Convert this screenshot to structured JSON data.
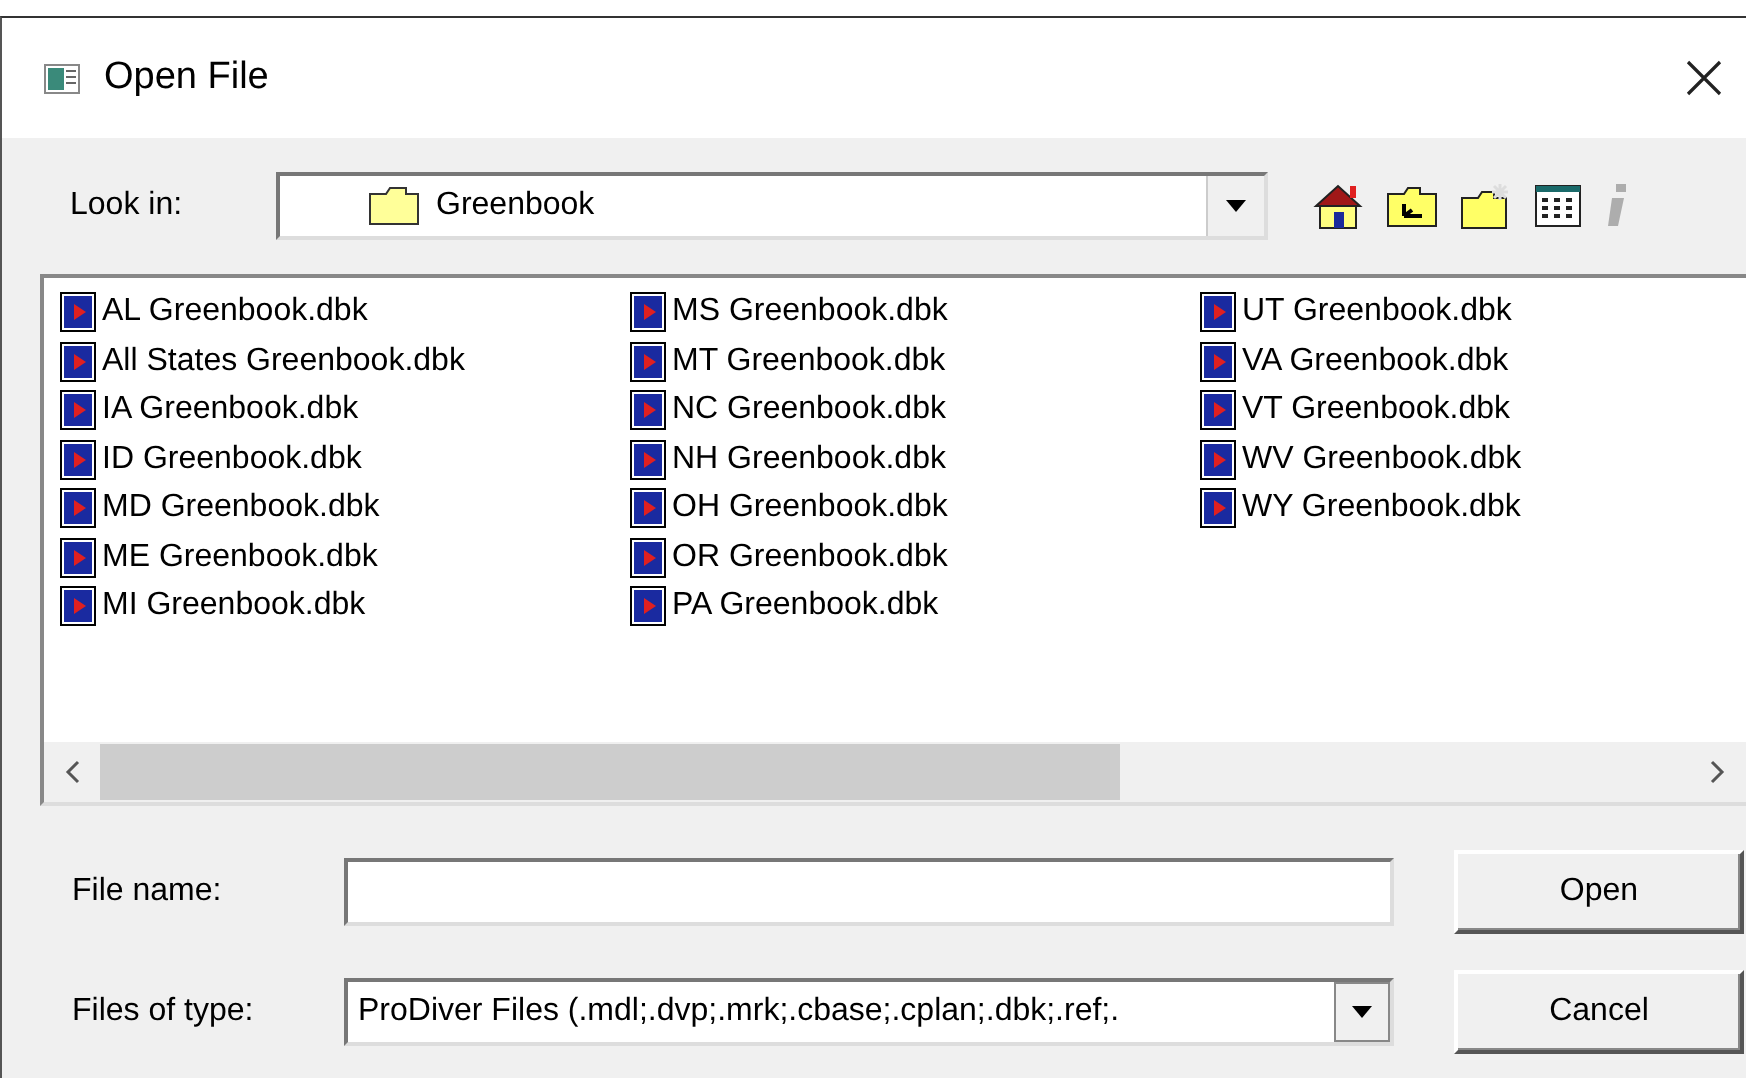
{
  "window": {
    "title": "Open File"
  },
  "look_in": {
    "label": "Look in:",
    "value": "Greenbook"
  },
  "toolbar": [
    {
      "kind": "home",
      "disabled": false
    },
    {
      "kind": "up-folder",
      "disabled": false
    },
    {
      "kind": "new-folder",
      "disabled": false
    },
    {
      "kind": "details",
      "disabled": false
    },
    {
      "kind": "info",
      "disabled": true
    }
  ],
  "files": [
    "AL Greenbook.dbk",
    "All States Greenbook.dbk",
    "IA Greenbook.dbk",
    "ID Greenbook.dbk",
    "MD Greenbook.dbk",
    "ME Greenbook.dbk",
    "MI Greenbook.dbk",
    "MS Greenbook.dbk",
    "MT Greenbook.dbk",
    "NC Greenbook.dbk",
    "NH Greenbook.dbk",
    "OH Greenbook.dbk",
    "OR Greenbook.dbk",
    "PA Greenbook.dbk",
    "UT Greenbook.dbk",
    "VA Greenbook.dbk",
    "VT Greenbook.dbk",
    "WV Greenbook.dbk",
    "WY Greenbook.dbk"
  ],
  "file_name": {
    "label": "File name:"
  },
  "file_type": {
    "label": "Files of type:",
    "value": "ProDiver Files (.mdl;.dvp;.mrk;.cbase;.cplan;.dbk;.ref;."
  },
  "buttons": [
    "Open",
    "Cancel"
  ]
}
